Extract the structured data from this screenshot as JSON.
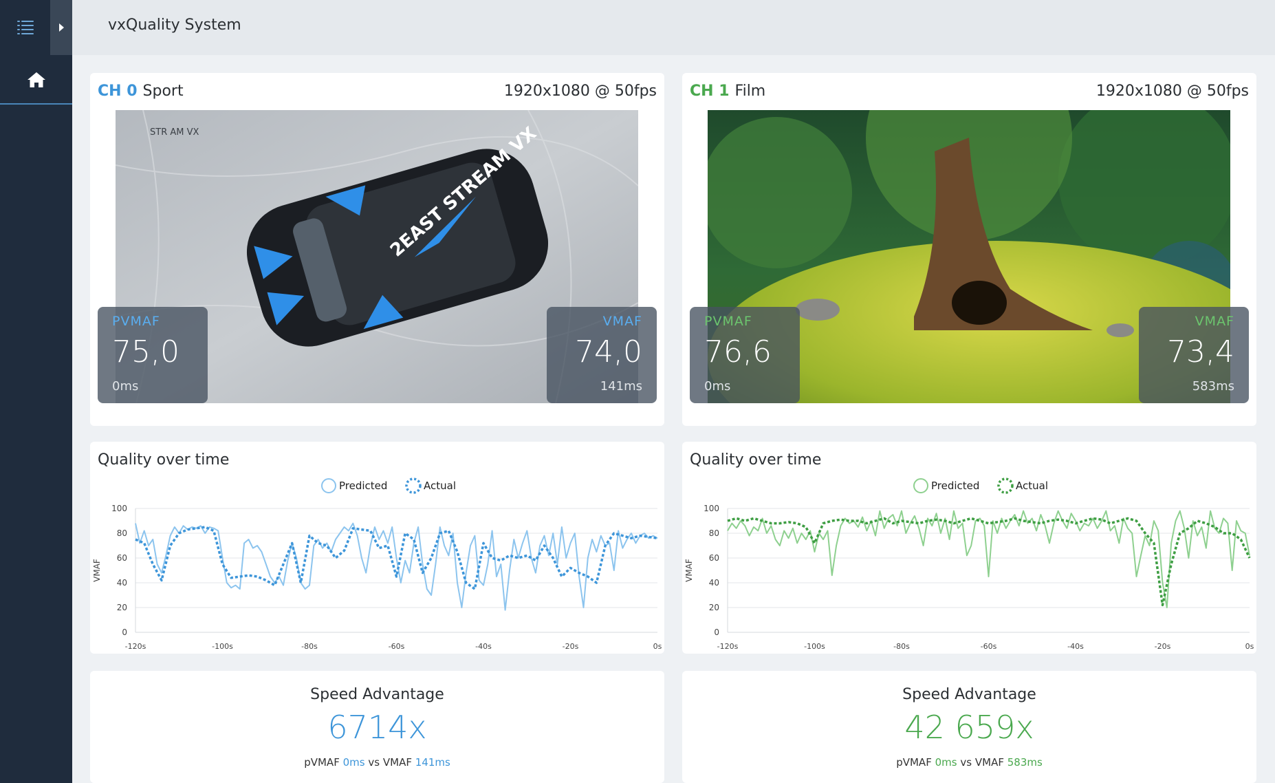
{
  "app": {
    "title": "vxQuality System"
  },
  "sidebar": {
    "menu_icon": "menu-icon",
    "expand_icon": "chevron-right-icon",
    "home_icon": "home-icon"
  },
  "colors": {
    "blue": "#3d95d9",
    "green": "#5ab55c",
    "sidebar": "#1f2c3d"
  },
  "channels": [
    {
      "id": "CH 0",
      "name": "Sport",
      "resolution": "1920x1080 @ 50fps",
      "pvmaf": {
        "label": "PVMAF",
        "value": "75,0",
        "latency": "0ms"
      },
      "vmaf": {
        "label": "VMAF",
        "value": "74,0",
        "latency": "141ms"
      },
      "watermark": "STR  AM VX",
      "car_text": "2EAST STREAM VX",
      "quality_title": "Quality over time",
      "speed": {
        "title": "Speed Advantage",
        "value": "6714x",
        "pvmaf_label": "pVMAF",
        "pvmaf_latency": "0ms",
        "vs": "vs",
        "vmaf_label": "VMAF",
        "vmaf_latency": "141ms"
      }
    },
    {
      "id": "CH 1",
      "name": "Film",
      "resolution": "1920x1080 @ 50fps",
      "pvmaf": {
        "label": "PVMAF",
        "value": "76,6",
        "latency": "0ms"
      },
      "vmaf": {
        "label": "VMAF",
        "value": "73,4",
        "latency": "583ms"
      },
      "quality_title": "Quality over time",
      "speed": {
        "title": "Speed Advantage",
        "value": "42 659x",
        "pvmaf_label": "pVMAF",
        "pvmaf_latency": "0ms",
        "vs": "vs",
        "vmaf_label": "VMAF",
        "vmaf_latency": "583ms"
      }
    }
  ],
  "chart_data": [
    {
      "type": "line",
      "ylabel": "VMAF",
      "ylim": [
        0,
        100
      ],
      "xlim": [
        -120,
        0
      ],
      "yticks": [
        "0",
        "20",
        "40",
        "60",
        "80",
        "100"
      ],
      "xticks": [
        "-120s",
        "-100s",
        "-80s",
        "-60s",
        "-40s",
        "-20s",
        "0s"
      ],
      "legend": "top-center",
      "grid": true,
      "series": [
        {
          "name": "Predicted",
          "style": "solid",
          "color": "#8cc4ee",
          "x": [
            -120,
            -119,
            -118,
            -117,
            -116,
            -115,
            -114,
            -113,
            -112,
            -111,
            -110,
            -109,
            -108,
            -107,
            -106,
            -105,
            -104,
            -103,
            -102,
            -101,
            -100,
            -99,
            -98,
            -97,
            -96,
            -95,
            -94,
            -93,
            -92,
            -91,
            -90,
            -89,
            -88,
            -87,
            -86,
            -85,
            -84,
            -83,
            -82,
            -81,
            -80,
            -79,
            -78,
            -77,
            -76,
            -75,
            -74,
            -73,
            -72,
            -71,
            -70,
            -69,
            -68,
            -67,
            -66,
            -65,
            -64,
            -63,
            -62,
            -61,
            -60,
            -59,
            -58,
            -57,
            -56,
            -55,
            -54,
            -53,
            -52,
            -51,
            -50,
            -49,
            -48,
            -47,
            -46,
            -45,
            -44,
            -43,
            -42,
            -41,
            -40,
            -39,
            -38,
            -37,
            -36,
            -35,
            -34,
            -33,
            -32,
            -31,
            -30,
            -29,
            -28,
            -27,
            -26,
            -25,
            -24,
            -23,
            -22,
            -21,
            -20,
            -19,
            -18,
            -17,
            -16,
            -15,
            -14,
            -13,
            -12,
            -11,
            -10,
            -9,
            -8,
            -7,
            -6,
            -5,
            -4,
            -3,
            -2,
            -1,
            0
          ],
          "y": [
            88,
            72,
            82,
            70,
            75,
            55,
            48,
            62,
            78,
            85,
            80,
            86,
            83,
            85,
            84,
            86,
            80,
            85,
            84,
            82,
            60,
            40,
            36,
            38,
            35,
            72,
            75,
            68,
            70,
            65,
            55,
            45,
            40,
            45,
            38,
            58,
            72,
            60,
            40,
            35,
            38,
            70,
            75,
            68,
            72,
            65,
            75,
            80,
            85,
            82,
            88,
            78,
            60,
            48,
            70,
            85,
            75,
            82,
            72,
            85,
            60,
            40,
            58,
            48,
            72,
            85,
            55,
            35,
            30,
            55,
            85,
            70,
            62,
            80,
            40,
            20,
            48,
            70,
            78,
            42,
            38,
            55,
            82,
            45,
            55,
            18,
            50,
            75,
            60,
            72,
            82,
            60,
            48,
            70,
            78,
            62,
            80,
            55,
            85,
            60,
            72,
            80,
            45,
            20,
            60,
            75,
            65,
            78,
            70,
            72,
            50,
            82,
            68,
            75,
            80,
            72,
            78,
            80,
            76,
            78,
            76
          ]
        },
        {
          "name": "Actual",
          "style": "dotted",
          "color": "#3d95d9",
          "x": [
            -120,
            -118,
            -116,
            -114,
            -112,
            -110,
            -108,
            -106,
            -104,
            -102,
            -100,
            -98,
            -96,
            -94,
            -92,
            -90,
            -88,
            -86,
            -84,
            -82,
            -80,
            -78,
            -76,
            -74,
            -72,
            -70,
            -68,
            -66,
            -64,
            -62,
            -60,
            -58,
            -56,
            -54,
            -52,
            -50,
            -48,
            -46,
            -44,
            -42,
            -40,
            -38,
            -36,
            -34,
            -32,
            -30,
            -28,
            -26,
            -24,
            -22,
            -20,
            -18,
            -16,
            -14,
            -12,
            -10,
            -8,
            -6,
            -4,
            -2,
            0
          ],
          "y": [
            75,
            72,
            55,
            42,
            70,
            80,
            83,
            84,
            85,
            82,
            55,
            44,
            45,
            46,
            45,
            42,
            38,
            55,
            72,
            40,
            78,
            72,
            70,
            60,
            66,
            84,
            83,
            82,
            68,
            70,
            45,
            80,
            75,
            48,
            60,
            80,
            82,
            65,
            40,
            35,
            72,
            60,
            58,
            62,
            60,
            62,
            58,
            70,
            60,
            45,
            52,
            48,
            45,
            40,
            70,
            80,
            78,
            76,
            78,
            77,
            76
          ]
        }
      ]
    },
    {
      "type": "line",
      "ylabel": "VMAF",
      "ylim": [
        0,
        100
      ],
      "xlim": [
        -120,
        0
      ],
      "yticks": [
        "0",
        "20",
        "40",
        "60",
        "80",
        "100"
      ],
      "xticks": [
        "-120s",
        "-100s",
        "-80s",
        "-60s",
        "-40s",
        "-20s",
        "0s"
      ],
      "legend": "top-center",
      "grid": true,
      "series": [
        {
          "name": "Predicted",
          "style": "solid",
          "color": "#8ed08f",
          "x": [
            -120,
            -119,
            -118,
            -117,
            -116,
            -115,
            -114,
            -113,
            -112,
            -111,
            -110,
            -109,
            -108,
            -107,
            -106,
            -105,
            -104,
            -103,
            -102,
            -101,
            -100,
            -99,
            -98,
            -97,
            -96,
            -95,
            -94,
            -93,
            -92,
            -91,
            -90,
            -89,
            -88,
            -87,
            -86,
            -85,
            -84,
            -83,
            -82,
            -81,
            -80,
            -79,
            -78,
            -77,
            -76,
            -75,
            -74,
            -73,
            -72,
            -71,
            -70,
            -69,
            -68,
            -67,
            -66,
            -65,
            -64,
            -63,
            -62,
            -61,
            -60,
            -59,
            -58,
            -57,
            -56,
            -55,
            -54,
            -53,
            -52,
            -51,
            -50,
            -49,
            -48,
            -47,
            -46,
            -45,
            -44,
            -43,
            -42,
            -41,
            -40,
            -39,
            -38,
            -37,
            -36,
            -35,
            -34,
            -33,
            -32,
            -31,
            -30,
            -29,
            -28,
            -27,
            -26,
            -25,
            -24,
            -23,
            -22,
            -21,
            -20,
            -19,
            -18,
            -17,
            -16,
            -15,
            -14,
            -13,
            -12,
            -11,
            -10,
            -9,
            -8,
            -7,
            -6,
            -5,
            -4,
            -3,
            -2,
            -1,
            0
          ],
          "y": [
            82,
            88,
            84,
            90,
            86,
            78,
            85,
            82,
            92,
            80,
            86,
            75,
            70,
            82,
            76,
            84,
            72,
            80,
            75,
            82,
            65,
            80,
            75,
            82,
            46,
            70,
            86,
            92,
            88,
            90,
            85,
            93,
            82,
            90,
            78,
            98,
            84,
            92,
            95,
            86,
            98,
            80,
            88,
            94,
            84,
            70,
            92,
            86,
            96,
            80,
            92,
            75,
            98,
            84,
            88,
            62,
            70,
            90,
            92,
            86,
            45,
            90,
            80,
            92,
            84,
            90,
            95,
            86,
            98,
            88,
            92,
            82,
            95,
            86,
            72,
            88,
            98,
            90,
            84,
            96,
            90,
            82,
            88,
            86,
            92,
            84,
            90,
            98,
            82,
            86,
            72,
            92,
            84,
            80,
            45,
            62,
            78,
            70,
            90,
            82,
            40,
            20,
            72,
            90,
            98,
            84,
            60,
            90,
            78,
            85,
            68,
            98,
            84,
            80,
            92,
            88,
            50,
            90,
            82,
            80,
            62
          ]
        },
        {
          "name": "Actual",
          "style": "dotted",
          "color": "#3e9e43",
          "x": [
            -120,
            -118,
            -116,
            -114,
            -112,
            -110,
            -108,
            -106,
            -104,
            -102,
            -100,
            -98,
            -96,
            -94,
            -92,
            -90,
            -88,
            -86,
            -84,
            -82,
            -80,
            -78,
            -76,
            -74,
            -72,
            -70,
            -68,
            -66,
            -64,
            -62,
            -60,
            -58,
            -56,
            -54,
            -52,
            -50,
            -48,
            -46,
            -44,
            -42,
            -40,
            -38,
            -36,
            -34,
            -32,
            -30,
            -28,
            -26,
            -24,
            -22,
            -20,
            -18,
            -16,
            -14,
            -12,
            -10,
            -8,
            -6,
            -4,
            -2,
            0
          ],
          "y": [
            90,
            92,
            90,
            92,
            90,
            88,
            88,
            89,
            88,
            85,
            72,
            88,
            90,
            91,
            90,
            90,
            88,
            90,
            92,
            88,
            90,
            89,
            88,
            90,
            91,
            90,
            88,
            90,
            92,
            90,
            88,
            89,
            90,
            92,
            90,
            89,
            88,
            90,
            91,
            90,
            88,
            90,
            92,
            91,
            88,
            90,
            92,
            90,
            80,
            72,
            22,
            55,
            80,
            84,
            90,
            88,
            85,
            80,
            80,
            75,
            60
          ]
        }
      ]
    }
  ]
}
